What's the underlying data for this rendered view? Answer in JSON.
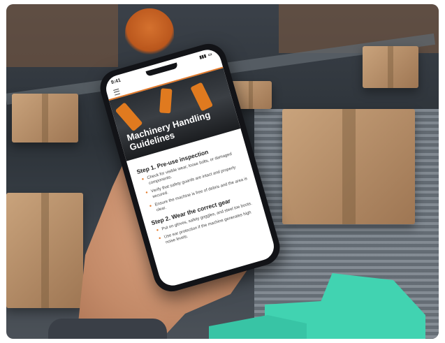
{
  "phone": {
    "status_time": "9:41",
    "hero_title": "Machinery Handling Guidelines",
    "steps": [
      {
        "title": "Step 1. Pre-use inspection",
        "items": [
          "Check for visible wear, loose bolts, or damaged components.",
          "Verify that safety guards are intact and properly secured.",
          "Ensure the machine is free of debris and the area is clear."
        ]
      },
      {
        "title": "Step 2. Wear the correct gear",
        "items": [
          "Put on gloves, safety goggles, and steel toe boots.",
          "Use ear protection if the machine generates high noise levels."
        ]
      }
    ]
  },
  "colors": {
    "accent": "#e37a2b",
    "teal_shape": "#41d3b1"
  },
  "icons": {
    "menu": "menu-icon",
    "signal": "signal-icon",
    "battery": "battery-icon"
  }
}
